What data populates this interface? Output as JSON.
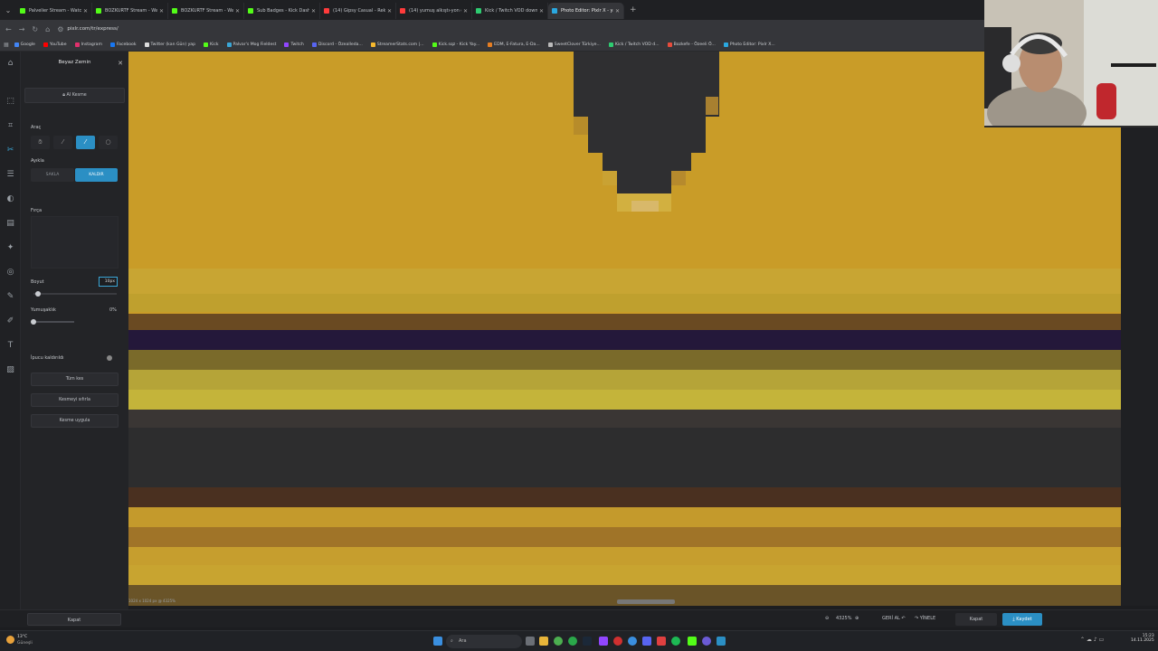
{
  "tabs": [
    {
      "label": "Palvelier Stream - Watch Live o",
      "color": "#53fc18"
    },
    {
      "label": "BOZKURTF Stream - Watch Li",
      "color": "#53fc18"
    },
    {
      "label": "BOZKURTF Stream - Watch Li",
      "color": "#53fc18"
    },
    {
      "label": "Sub Badges - Kick Dashboard",
      "color": "#53fc18"
    },
    {
      "label": "(14) Gipsy Casual - Rekabhi",
      "color": "#ff3b3b"
    },
    {
      "label": "(14) yumuş alkıştı-yon geçi - Y",
      "color": "#ff3b3b"
    },
    {
      "label": "Kick / Twitch VOD downloader",
      "color": "#2ecc71"
    },
    {
      "label": "Photo Editor: Pixlr X - yaratıcı",
      "color": "#2aa8e0",
      "active": true
    }
  ],
  "url": "pixlr.com/tr/express/",
  "bookmarks": [
    {
      "label": "Google",
      "color": "#4285f4"
    },
    {
      "label": "YouTube",
      "color": "#ff0000"
    },
    {
      "label": "Instagram",
      "color": "#e1306c"
    },
    {
      "label": "Facebook",
      "color": "#1877f2"
    },
    {
      "label": "Twitter (kan Gün) yap",
      "color": "#dddddd"
    },
    {
      "label": "Kick",
      "color": "#53fc18"
    },
    {
      "label": "Palvar's Mog Fieldest",
      "color": "#3aa6d6"
    },
    {
      "label": "Twitch",
      "color": "#9146ff"
    },
    {
      "label": "Discord - Özealleda...",
      "color": "#5865f2"
    },
    {
      "label": "StreamerStats.com |...",
      "color": "#f5b82e"
    },
    {
      "label": "Kick.sqz - Kick Yay...",
      "color": "#53fc18"
    },
    {
      "label": "EDM, E-Fatura, E-Da...",
      "color": "#e67e22"
    },
    {
      "label": "SweetClover Türkiye...",
      "color": "#bbbbbb"
    },
    {
      "label": "Kick / Twitch VOD d...",
      "color": "#2ecc71"
    },
    {
      "label": "Bozkefe - Özeeli Ö...",
      "color": "#e74c3c"
    },
    {
      "label": "Photo Editor: Pixlr X...",
      "color": "#2aa8e0"
    }
  ],
  "panel": {
    "title": "Beyaz Zemin",
    "ai_button": "AI Kesme",
    "tool_label": "Araç",
    "mode_label": "Ayıkla",
    "mode_left": "SAKLA",
    "mode_right": "KALDIR",
    "brush_label": "Fırça",
    "size_label": "Boyut",
    "size_value": "10px",
    "softness_label": "Yumuşaklık",
    "softness_value": "0%",
    "tip_label": "İpucu kaldırıldı",
    "btn_clear": "Tüm kes",
    "btn_reset": "Kesmeyi sıfırla",
    "btn_apply": "Kesme uygula",
    "close_button": "Kapat",
    "size_fraction": 0.05,
    "softness_fraction": 0.0
  },
  "canvas": {
    "info": "1024 x 1024 px @ 4325%"
  },
  "bottom": {
    "zoom": "4325%",
    "undo": "GERİ AL",
    "redo": "YİNELE",
    "close": "Kapat",
    "save": "Kaydet"
  },
  "taskbar": {
    "weather_temp": "13°C",
    "weather_text": "Güneşli",
    "search": "Ara",
    "time": "15:23",
    "date": "14.11.2025"
  },
  "colors": {
    "accent": "#2b8fc4",
    "canvas_yellow": "#c89a26",
    "dark_band": "#262626"
  }
}
